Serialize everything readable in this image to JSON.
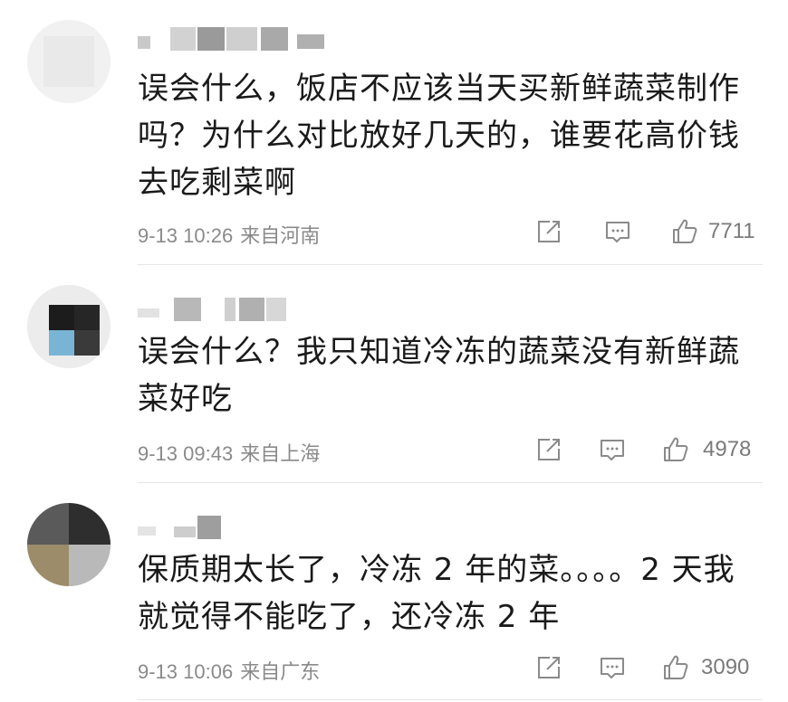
{
  "comments": [
    {
      "text": "误会什么，饭店不应该当天买新鲜蔬菜制作吗？为什么对比放好几天的，谁要花高价钱去吃剩菜啊",
      "date": "9-13 10:26",
      "location": "来自河南",
      "likes": "7711",
      "icons": [
        "share-icon",
        "comment-icon",
        "like-icon"
      ]
    },
    {
      "text": "误会什么？我只知道冷冻的蔬菜没有新鲜蔬菜好吃",
      "date": "9-13 09:43",
      "location": "来自上海",
      "likes": "4978",
      "icons": [
        "share-icon",
        "comment-icon",
        "like-icon"
      ]
    },
    {
      "text": "保质期太长了，冷冻 2 年的菜。。。。2 天我就觉得不能吃了，还冷冻 2 年",
      "date": "9-13 10:06",
      "location": "来自广东",
      "likes": "3090",
      "icons": [
        "share-icon",
        "comment-icon",
        "like-icon"
      ]
    }
  ],
  "colors": {
    "text": "#1a1a1a",
    "meta": "#8a8a8a",
    "icon": "#8a8a8a",
    "divider": "#e6e6e6"
  }
}
